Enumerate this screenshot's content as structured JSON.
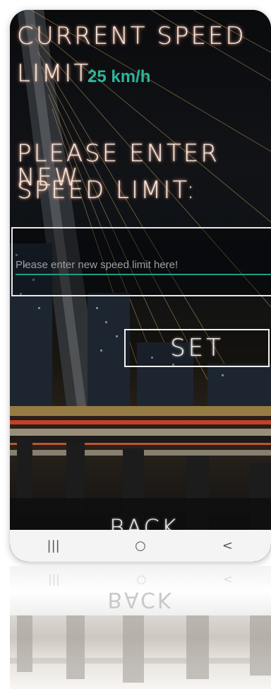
{
  "labels": {
    "current_speed": "CURRENT SPEED",
    "limit_prefix": "LIMIT:",
    "current_value": "25 km/h",
    "please_enter": "PLEASE ENTER NEW",
    "speed_limit": "SPEED LIMIT:"
  },
  "input": {
    "value": "",
    "placeholder": "Please enter new speed limit here!"
  },
  "buttons": {
    "set": "SET",
    "back": "BACK"
  },
  "navbar": {
    "recent_icon": "recent-apps-icon",
    "home_icon": "home-icon",
    "back_icon": "back-arrow-icon",
    "recent_glyph": "|||",
    "home_glyph": "○",
    "back_glyph": "<"
  },
  "colors": {
    "accent": "#2bb59a",
    "underline": "#1f9c86",
    "glow_text": "#f4e7df"
  }
}
